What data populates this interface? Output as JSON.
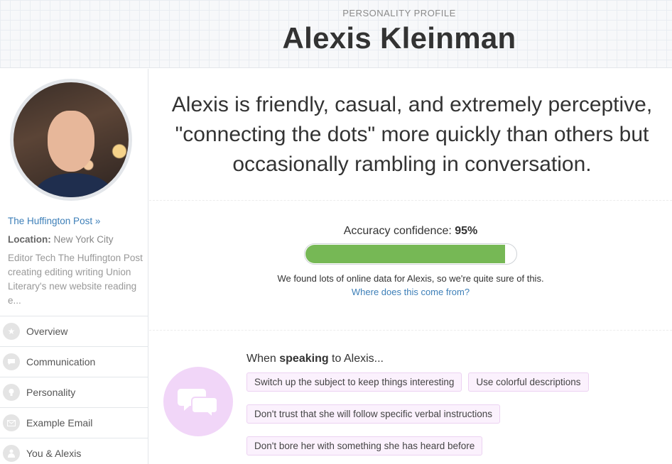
{
  "header": {
    "eyebrow": "PERSONALITY PROFILE",
    "name": "Alexis Kleinman"
  },
  "sidebar": {
    "link": "The Huffington Post »",
    "location_label": "Location:",
    "location_value": "New York City",
    "bio": "Editor Tech The Huffington Post creating editing writing Union Literary's new website reading e...",
    "nav": [
      {
        "label": "Overview",
        "icon": "star-icon"
      },
      {
        "label": "Communication",
        "icon": "speech-bubble-icon"
      },
      {
        "label": "Personality",
        "icon": "lightbulb-icon"
      },
      {
        "label": "Example Email",
        "icon": "envelope-icon"
      },
      {
        "label": "You & Alexis",
        "icon": "person-icon"
      }
    ]
  },
  "main": {
    "summary": "Alexis is friendly, casual, and extremely perceptive, \"connecting the dots\" more quickly than others but occasionally rambling in conversation.",
    "accuracy": {
      "label": "Accuracy confidence:",
      "value": "95%",
      "fill_fraction": 0.95,
      "note": "We found lots of online data for Alexis, so we're quite sure of this.",
      "source_link": "Where does this come from?"
    },
    "speaking": {
      "title_prefix": "When ",
      "title_bold": "speaking",
      "title_suffix": " to Alexis...",
      "tags": [
        "Switch up the subject to keep things interesting",
        "Use colorful descriptions",
        "Don't trust that she will follow specific verbal instructions",
        "Don't bore her with something she has heard before"
      ]
    }
  },
  "colors": {
    "accent_link": "#3d7fb8",
    "progress_fill": "#76b855",
    "tag_bg": "#fbf1fd",
    "speaking_icon_bg": "#f1d6f8"
  }
}
